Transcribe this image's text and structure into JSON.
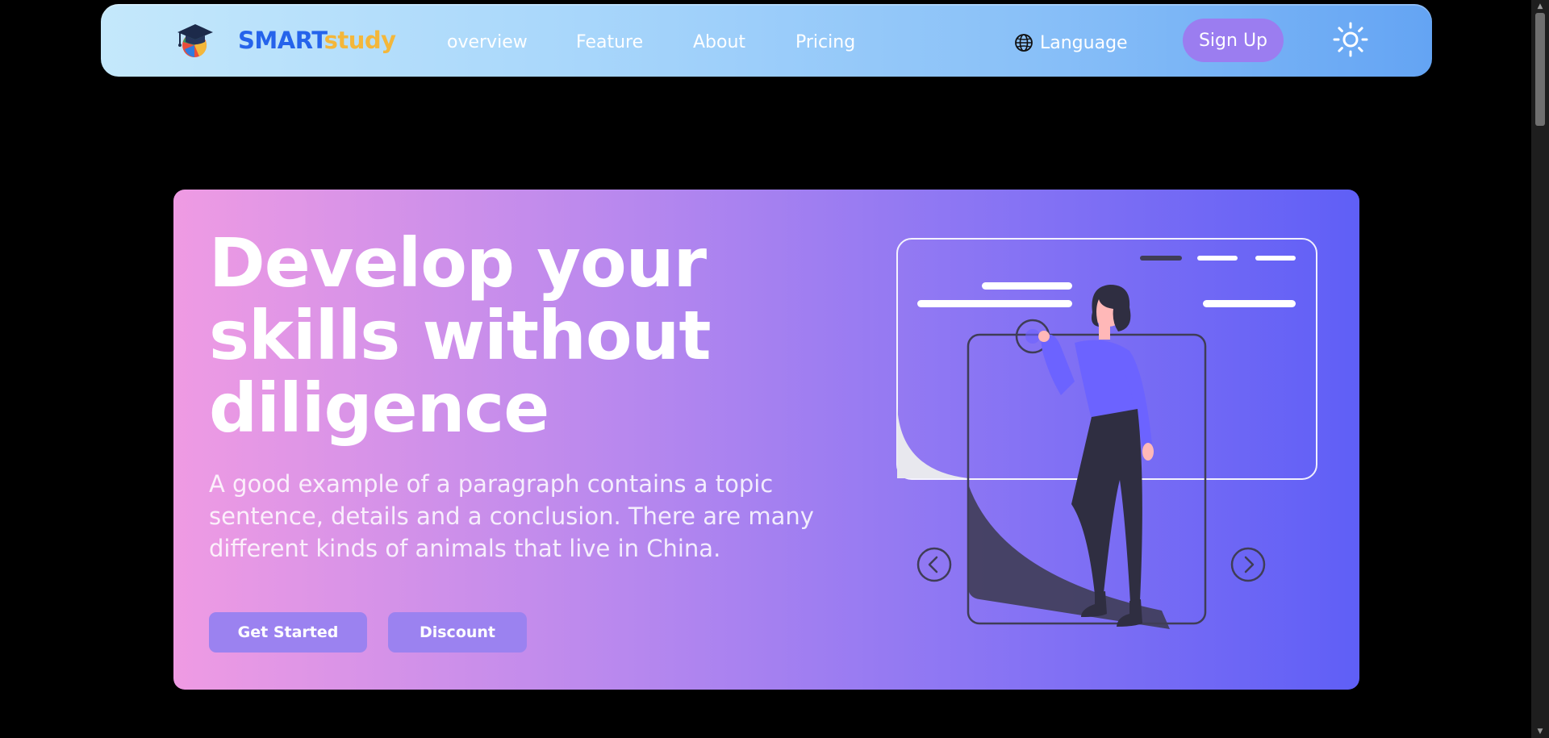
{
  "navbar": {
    "logo_icon": "graduation-cap-logo",
    "brand_part1": "SMART",
    "brand_part2": "study",
    "links": [
      "overview",
      "Feature",
      "About",
      "Pricing"
    ],
    "language_label": "Language",
    "language_icon": "globe-icon",
    "signup_label": "Sign Up",
    "theme_icon": "sun-icon"
  },
  "hero": {
    "headline": "Develop your skills without diligence",
    "description": "A good example of a paragraph contains a topic sentence, details and a conclusion. There are many different kinds of animals that live in China.",
    "primary_button": "Get Started",
    "secondary_button": "Discount",
    "illustration": "woman-presenting-slides-illustration",
    "prev_icon": "chevron-left-circle-icon",
    "next_icon": "chevron-right-circle-icon"
  },
  "colors": {
    "brand_blue": "#2563eb",
    "brand_yellow": "#f4b73a",
    "signup_bg": "#9b7df0",
    "button_bg": "#9b82f0",
    "hero_start": "#ef9be3",
    "hero_end": "#5f5ff6"
  }
}
